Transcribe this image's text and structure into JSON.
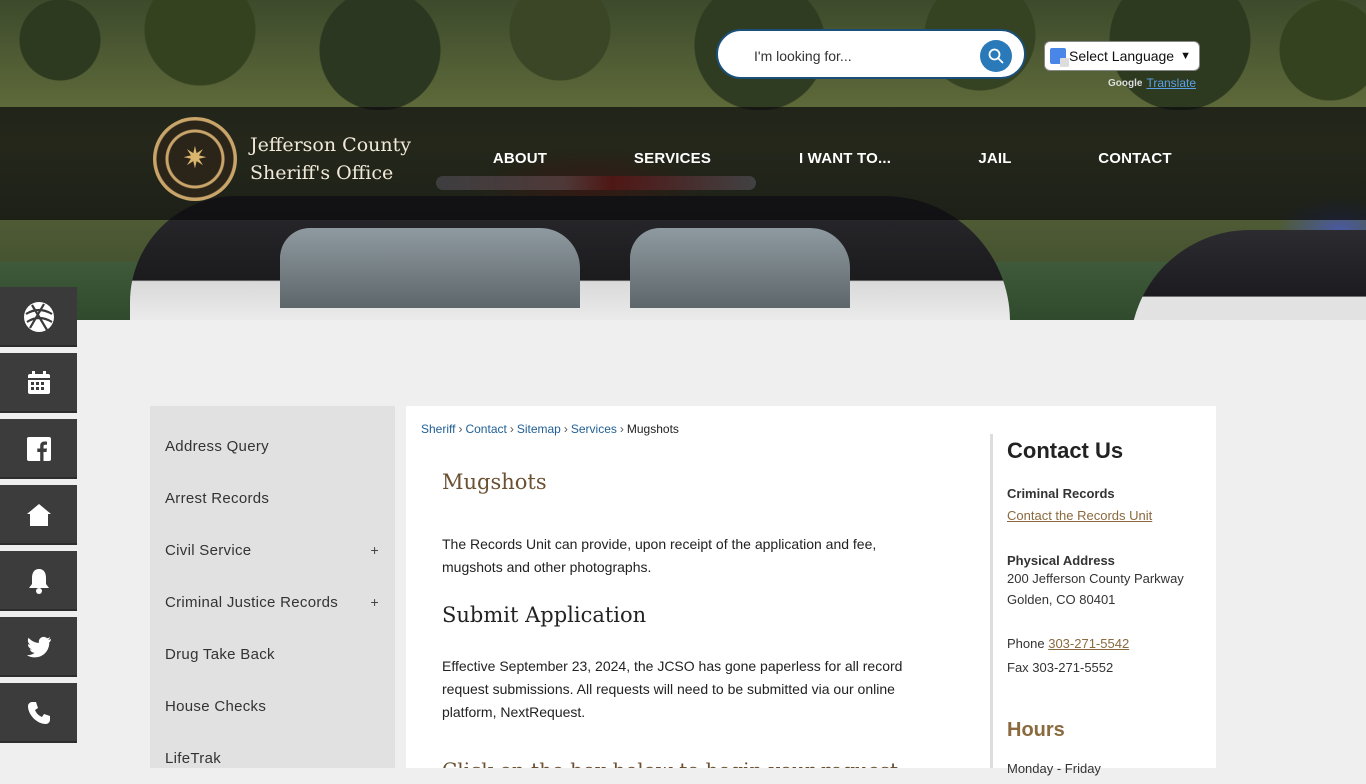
{
  "search": {
    "placeholder": "I'm looking for..."
  },
  "translate": {
    "select_label": "Select Language",
    "powered_by": "Google",
    "translate_label": "Translate"
  },
  "brand": {
    "line1": "Jefferson County",
    "line2": "Sheriff's Office"
  },
  "nav": [
    {
      "label": "ABOUT"
    },
    {
      "label": "SERVICES"
    },
    {
      "label": "I WANT TO..."
    },
    {
      "label": "JAIL"
    },
    {
      "label": "CONTACT"
    }
  ],
  "rail": [
    {
      "icon": "globe-icon"
    },
    {
      "icon": "calendar-icon"
    },
    {
      "icon": "facebook-icon"
    },
    {
      "icon": "home-icon"
    },
    {
      "icon": "bell-icon"
    },
    {
      "icon": "twitter-icon"
    },
    {
      "icon": "phone-icon"
    }
  ],
  "sidenav": [
    {
      "label": "Address Query",
      "expandable": false
    },
    {
      "label": "Arrest Records",
      "expandable": false
    },
    {
      "label": "Civil Service",
      "expandable": true
    },
    {
      "label": "Criminal Justice Records",
      "expandable": true
    },
    {
      "label": "Drug Take Back",
      "expandable": false
    },
    {
      "label": "House Checks",
      "expandable": false
    },
    {
      "label": "LifeTrak",
      "expandable": false
    }
  ],
  "breadcrumb": [
    "Sheriff",
    "Contact",
    "Sitemap",
    "Services"
  ],
  "breadcrumb_current": "Mugshots",
  "page": {
    "title": "Mugshots",
    "intro": "The Records Unit can provide, upon receipt of the application and fee, mugshots and other photographs.",
    "sub_heading": "Submit Application",
    "body": "Effective September 23, 2024, the JCSO has gone paperless for all record request submissions. All requests will need to be submitted via our online platform, NextRequest.",
    "cut_heading": "Click on the box below to begin your request"
  },
  "contact": {
    "heading": "Contact Us",
    "dept": "Criminal Records",
    "dept_link": "Contact the Records Unit",
    "address_label": "Physical Address",
    "address_line1": "200 Jefferson County Parkway",
    "address_line2": "Golden, CO 80401",
    "phone_label": "Phone",
    "phone": "303-271-5542",
    "fax": "Fax 303-271-5552",
    "hours_heading": "Hours",
    "hours_days": "Monday - Friday"
  },
  "colors": {
    "accent_gold": "#8a6a3e",
    "link_blue": "#1f5f95",
    "search_blue": "#2a79b8"
  }
}
